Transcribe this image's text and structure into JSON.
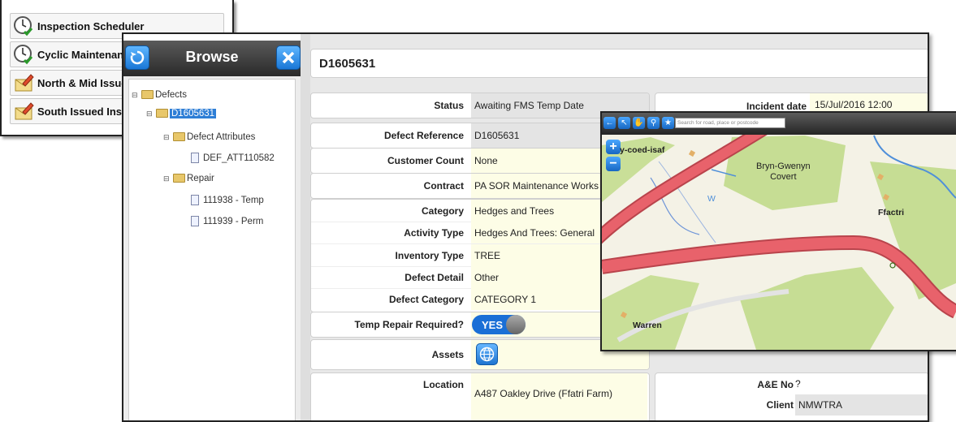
{
  "scheduler_list": {
    "items": [
      {
        "label": "Inspection Scheduler",
        "icon": "clock-check-icon"
      },
      {
        "label": "Cyclic Maintenance",
        "icon": "clock-check-icon"
      },
      {
        "label": "North & Mid Issued",
        "icon": "envelope-pencil-icon"
      },
      {
        "label": "South Issued Insp",
        "icon": "envelope-pencil-icon"
      }
    ]
  },
  "browse": {
    "title": "Browse",
    "tree": {
      "root": "Defects",
      "defect": "D1605631",
      "attributes_folder": "Defect Attributes",
      "attribute_item": "DEF_ATT110582",
      "repair_folder": "Repair",
      "repair_items": [
        "111938 - Temp",
        "111939 - Perm"
      ]
    }
  },
  "defect": {
    "header": "D1605631",
    "fields": {
      "status": {
        "label": "Status",
        "value": "Awaiting FMS Temp Date"
      },
      "reference": {
        "label": "Defect Reference",
        "value": "D1605631"
      },
      "customer_count": {
        "label": "Customer Count",
        "value": "None"
      },
      "contract": {
        "label": "Contract",
        "value": "PA SOR Maintenance Works ("
      },
      "category": {
        "label": "Category",
        "value": "Hedges and Trees"
      },
      "activity_type": {
        "label": "Activity Type",
        "value": "Hedges And Trees: General"
      },
      "inventory_type": {
        "label": "Inventory Type",
        "value": "TREE"
      },
      "defect_detail": {
        "label": "Defect Detail",
        "value": "Other"
      },
      "defect_category": {
        "label": "Defect Category",
        "value": "CATEGORY 1"
      },
      "temp_repair": {
        "label": "Temp Repair Required?",
        "value": "YES"
      },
      "assets": {
        "label": "Assets"
      },
      "location": {
        "label": "Location",
        "value": "A487 Oakley Drive (Ffatri Farm)"
      },
      "incident_date": {
        "label": "Incident date",
        "value": "15/Jul/2016 12:00"
      },
      "ae_no": {
        "label": "A&E No",
        "value": "?"
      },
      "client": {
        "label": "Client",
        "value": "NMWTRA"
      }
    }
  },
  "map": {
    "search_placeholder": "Search for road, place or postcode",
    "labels": {
      "place1": "y-coed-isaf",
      "place2a": "Bryn-Gwenyn",
      "place2b": "Covert",
      "place3": "Ffactri",
      "place4": "Warren",
      "water": "W"
    },
    "colors": {
      "road": "#e8626b",
      "woodland": "#c6dd94",
      "water": "#4f8fd9"
    }
  }
}
